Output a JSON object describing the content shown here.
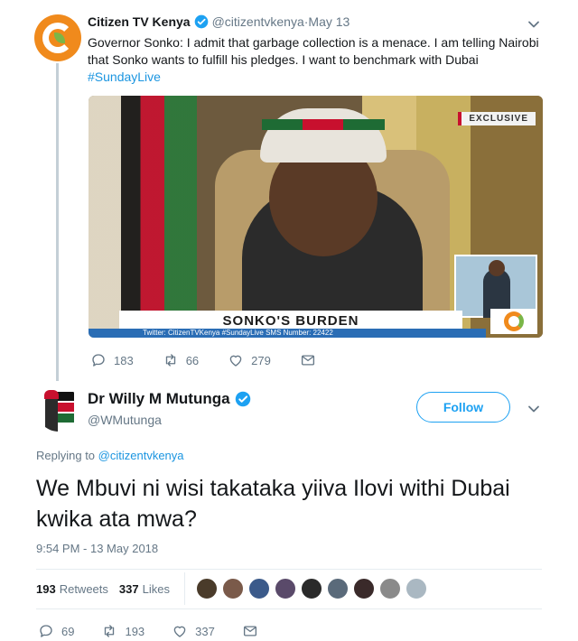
{
  "colors": {
    "link_blue": "#1b95e0",
    "follow_blue": "#1da1f2",
    "muted": "#657786",
    "text": "#14171a",
    "citizen_orange": "#f08a1c"
  },
  "parent_tweet": {
    "name": "Citizen TV Kenya",
    "handle": "@citizentvkenya",
    "separator": " · ",
    "date": "May 13",
    "text": "Governor Sonko: I admit that garbage collection is a menace. I am telling Nairobi that Sonko wants to fulfill his pledges. I want to benchmark with Dubai ",
    "hashtag": "#SundayLive",
    "media": {
      "badge": "EXCLUSIVE",
      "banner": "SONKO'S BURDEN",
      "ticker": "Twitter: CitizenTVKenya    #SundayLive    SMS Number: 22422"
    },
    "actions": {
      "replies": "183",
      "retweets": "66",
      "likes": "279"
    }
  },
  "main_tweet": {
    "name": "Dr Willy M Mutunga",
    "handle": "@WMutunga",
    "follow_label": "Follow",
    "replying_prefix": "Replying to ",
    "replying_to": "@citizentvkenya",
    "text": "We Mbuvi ni wisi takataka yiiva Ilovi withi Dubai kwika ata mwa?",
    "timestamp": "9:54 PM - 13 May 2018",
    "stats": {
      "retweets_count": "193",
      "retweets_label": "Retweets",
      "likes_count": "337",
      "likes_label": "Likes"
    },
    "liker_colors": [
      "#4a3b2a",
      "#7a5a4a",
      "#3b5a8a",
      "#5a4a6a",
      "#2a2a2a",
      "#5a6a7a",
      "#3a2a2a",
      "#8a8a8a",
      "#aab8c2"
    ],
    "actions": {
      "replies": "69",
      "retweets": "193",
      "likes": "337"
    }
  }
}
